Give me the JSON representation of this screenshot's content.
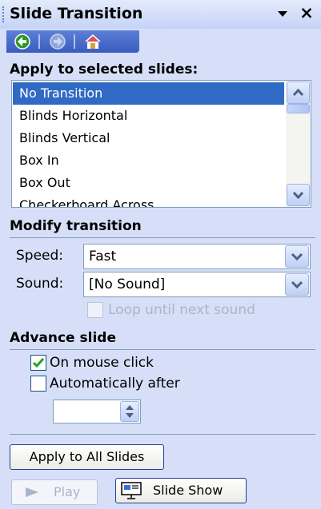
{
  "panel": {
    "title": "Slide Transition",
    "nav_icons": [
      "back-icon",
      "forward-icon",
      "home-icon"
    ]
  },
  "apply_section": {
    "header": "Apply to selected slides:",
    "items": [
      "No Transition",
      "Blinds Horizontal",
      "Blinds Vertical",
      "Box In",
      "Box Out",
      "Checkerboard Across"
    ],
    "selected_index": 0
  },
  "modify_section": {
    "header": "Modify transition",
    "speed_label": "Speed:",
    "speed_value": "Fast",
    "sound_label": "Sound:",
    "sound_value": "[No Sound]",
    "loop_label": "Loop until next sound",
    "loop_checked": false,
    "loop_enabled": false
  },
  "advance_section": {
    "header": "Advance slide",
    "on_click_label": "On mouse click",
    "on_click_checked": true,
    "auto_label": "Automatically after",
    "auto_checked": false,
    "auto_value": ""
  },
  "buttons": {
    "apply_all": "Apply to All Slides",
    "play": "Play",
    "slide_show": "Slide Show"
  },
  "colors": {
    "panel_bg": "#D6DFF7",
    "selection": "#316AC5",
    "nav_bar": "#3A5CC0",
    "check": "#21A121"
  }
}
